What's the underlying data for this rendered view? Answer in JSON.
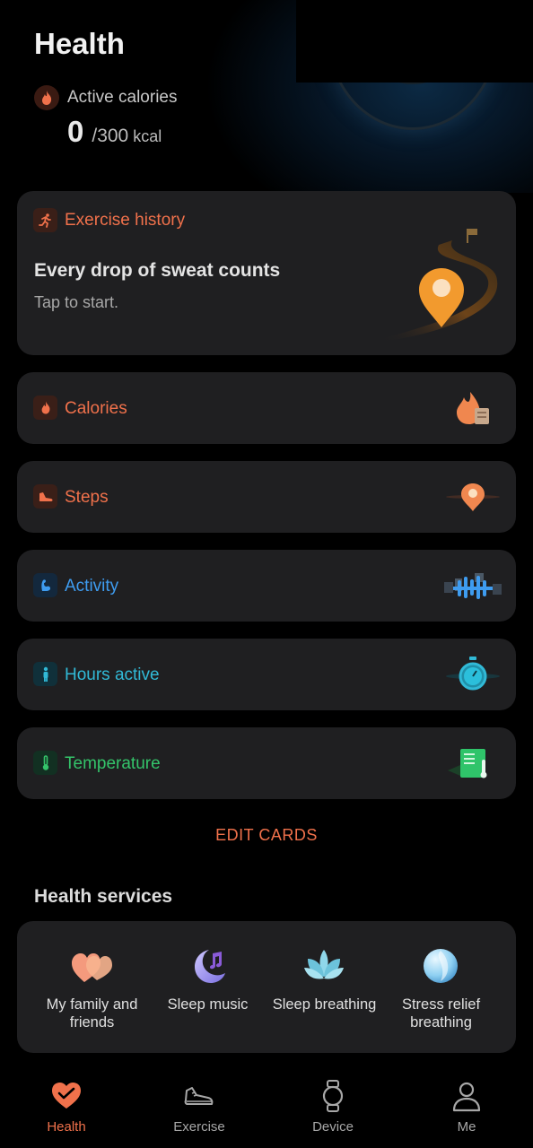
{
  "header": {
    "title": "Health",
    "active_calories": {
      "label": "Active calories",
      "value": "0",
      "goal": "/300",
      "unit": "kcal"
    }
  },
  "exercise_card": {
    "title": "Exercise history",
    "headline": "Every drop of sweat counts",
    "subtitle": "Tap to start."
  },
  "cards": [
    {
      "label": "Calories",
      "icon": "flame-icon",
      "color": "#f0714b"
    },
    {
      "label": "Steps",
      "icon": "shoe-icon",
      "color": "#f0714b"
    },
    {
      "label": "Activity",
      "icon": "flexed-arm-icon",
      "color": "#3e9cf0"
    },
    {
      "label": "Hours active",
      "icon": "standing-person-icon",
      "color": "#31b9d6"
    },
    {
      "label": "Temperature",
      "icon": "thermometer-icon",
      "color": "#34c46a"
    }
  ],
  "edit_cards_label": "EDIT CARDS",
  "services": {
    "title": "Health services",
    "items": [
      {
        "label": "My family and friends",
        "icon": "family-hearts-icon"
      },
      {
        "label": "Sleep music",
        "icon": "moon-music-icon"
      },
      {
        "label": "Sleep breathing",
        "icon": "lotus-icon"
      },
      {
        "label": "Stress relief breathing",
        "icon": "breathing-orb-icon"
      }
    ]
  },
  "bottom_nav": [
    {
      "label": "Health",
      "icon": "heart-icon",
      "active": true
    },
    {
      "label": "Exercise",
      "icon": "sneaker-icon",
      "active": false
    },
    {
      "label": "Device",
      "icon": "watch-icon",
      "active": false
    },
    {
      "label": "Me",
      "icon": "person-icon",
      "active": false
    }
  ],
  "colors": {
    "accent": "#f0714b",
    "background": "#000000",
    "card": "#1f1f21"
  }
}
